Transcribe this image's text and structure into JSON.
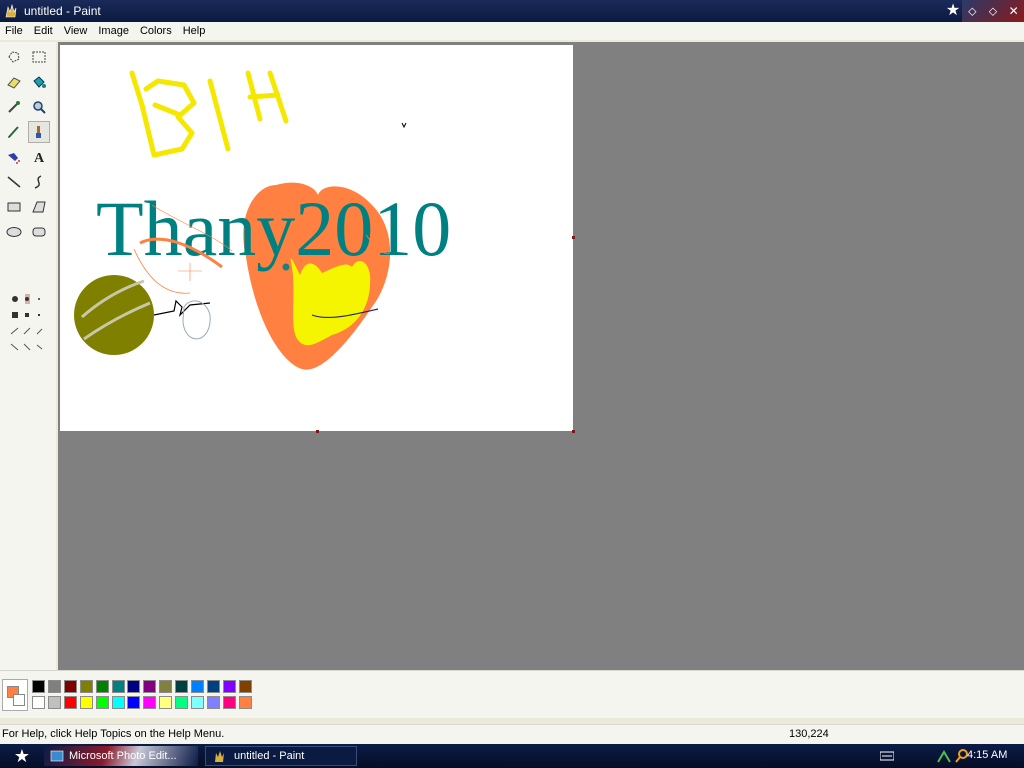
{
  "window": {
    "title": "untitled - Paint",
    "icon": "paint-app-icon",
    "controls": [
      "minimize",
      "maximize",
      "close"
    ]
  },
  "menu": [
    "File",
    "Edit",
    "View",
    "Image",
    "Colors",
    "Help"
  ],
  "tools": [
    "free-form-select",
    "select",
    "eraser",
    "fill-with-color",
    "pick-color",
    "magnifier",
    "pencil",
    "brush",
    "airbrush",
    "text",
    "line",
    "curve",
    "rectangle",
    "polygon",
    "ellipse",
    "rounded-rectangle"
  ],
  "selected_tool": "brush",
  "canvas": {
    "handwritten_text": "BIH",
    "text": "Thany2010",
    "text_color": "#008080"
  },
  "colors": {
    "foreground": "#ff8040",
    "background": "#ffffff",
    "palette_top": [
      "#000000",
      "#808080",
      "#800000",
      "#808000",
      "#008000",
      "#008080",
      "#000080",
      "#800080",
      "#808040",
      "#004040",
      "#0080ff",
      "#004080",
      "#8000ff",
      "#804000"
    ],
    "palette_bottom": [
      "#ffffff",
      "#c0c0c0",
      "#ff0000",
      "#ffff00",
      "#00ff00",
      "#00ffff",
      "#0000ff",
      "#ff00ff",
      "#ffff80",
      "#00ff80",
      "#80ffff",
      "#8080ff",
      "#ff0080",
      "#ff8040"
    ]
  },
  "status": {
    "help": "For Help, click Help Topics on the Help Menu.",
    "coords": "130,224"
  },
  "taskbar": {
    "tasks": [
      "Microsoft Photo Edit...",
      "untitled - Paint"
    ],
    "clock": "4:15 AM"
  }
}
